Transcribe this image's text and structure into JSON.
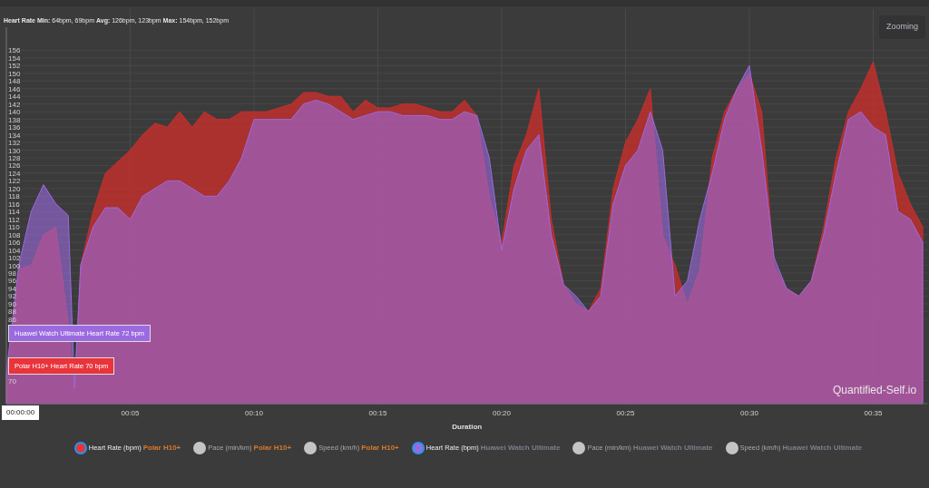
{
  "chart": {
    "title": "**Heart Rate Min:** 64bpm, 69bpm **Avg:** 126bpm, 123bpm **Max:** 154bpm, 152bpm",
    "zoom_button": "Zooming",
    "credit": "Quantified-Self.io",
    "crosshair_label": "00:00:00",
    "tooltips": [
      {
        "text": "Huawei Watch Ultimate Heart Rate 72 bpm",
        "color": "#9b6ae0"
      },
      {
        "text": "Polar H10+ Heart Rate 70 bpm",
        "color": "#e8343a"
      }
    ],
    "chart_data": {
      "type": "area",
      "grid": true,
      "xlabel": "Duration",
      "xlim": [
        0,
        37.2
      ],
      "ylim": [
        64,
        162
      ],
      "x": [
        0,
        0.5,
        1,
        1.5,
        2,
        2.5,
        2.75,
        3,
        3.5,
        4,
        4.5,
        5,
        5.5,
        6,
        6.5,
        7,
        7.5,
        8,
        8.5,
        9,
        9.5,
        10,
        10.5,
        11,
        11.5,
        12,
        12.5,
        13,
        13.5,
        14,
        14.5,
        15,
        15.5,
        16,
        16.5,
        17,
        17.5,
        18,
        18.5,
        19,
        19.5,
        20,
        20.5,
        21,
        21.5,
        22,
        22.5,
        23,
        23.5,
        24,
        24.5,
        25,
        25.5,
        26,
        26.5,
        27,
        27.5,
        28,
        28.5,
        29,
        29.5,
        30,
        30.5,
        31,
        31.5,
        32,
        32.5,
        33,
        33.5,
        34,
        34.5,
        35,
        35.5,
        36,
        36.5,
        37
      ],
      "xticks": [
        {
          "value": 5,
          "label": "00:05"
        },
        {
          "value": 10,
          "label": "00:10"
        },
        {
          "value": 15,
          "label": "00:15"
        },
        {
          "value": 20,
          "label": "00:20"
        },
        {
          "value": 25,
          "label": "00:25"
        },
        {
          "value": 30,
          "label": "00:30"
        },
        {
          "value": 35,
          "label": "00:35"
        }
      ],
      "yticks": [
        70,
        86,
        88,
        90,
        92,
        94,
        96,
        98,
        100,
        102,
        104,
        106,
        108,
        110,
        112,
        114,
        116,
        118,
        120,
        122,
        124,
        126,
        128,
        130,
        132,
        134,
        136,
        138,
        140,
        142,
        144,
        146,
        148,
        150,
        152,
        154,
        156
      ],
      "series": [
        {
          "color": "#c0302e",
          "values": [
            70,
            99,
            100,
            108,
            110,
            85,
            66,
            100,
            114,
            124,
            127,
            130,
            134,
            137,
            136,
            140,
            136,
            140,
            138,
            138,
            140,
            140,
            140,
            141,
            142,
            145,
            145,
            144,
            144,
            140,
            143,
            141,
            141,
            142,
            142,
            141,
            140,
            140,
            143,
            139,
            118,
            106,
            126,
            134,
            146,
            112,
            95,
            90,
            88,
            94,
            120,
            132,
            138,
            146,
            108,
            100,
            90,
            99,
            128,
            140,
            146,
            150,
            140,
            100,
            94,
            92,
            96,
            110,
            128,
            140,
            146,
            153,
            140,
            124,
            116,
            110
          ]
        },
        {
          "color": "#9b6ae0",
          "values": [
            72,
            100,
            114,
            121,
            116,
            113,
            68,
            100,
            110,
            115,
            115,
            112,
            118,
            120,
            122,
            122,
            120,
            118,
            118,
            122,
            128,
            138,
            138,
            138,
            138,
            142,
            143,
            142,
            140,
            138,
            139,
            140,
            140,
            139,
            139,
            139,
            138,
            138,
            140,
            139,
            128,
            104,
            120,
            130,
            134,
            108,
            95,
            92,
            88,
            92,
            116,
            126,
            130,
            140,
            130,
            92,
            96,
            112,
            124,
            138,
            146,
            152,
            130,
            102,
            94,
            92,
            96,
            108,
            124,
            138,
            140,
            136,
            134,
            114,
            112,
            106
          ]
        }
      ]
    }
  },
  "legend": [
    {
      "label": "Heart Rate (bpm)",
      "device": {
        "text": "Polar H10+",
        "color": "#d9782a"
      },
      "on": true,
      "color": "#e8343a"
    },
    {
      "label": "Pace (min/km)",
      "device": {
        "text": "Polar H10+",
        "color": "#d9782a"
      },
      "on": false
    },
    {
      "label": "Speed (km/h)",
      "device": {
        "text": "Polar H10+",
        "color": "#d9782a"
      },
      "on": false
    },
    {
      "label": "Heart Rate (bpm)",
      "device": {
        "text": "Huawei Watch Ultimate",
        "color": "#7a7f8c"
      },
      "on": true,
      "color": "#9b6ae0"
    },
    {
      "label": "Pace (min/km)",
      "device": {
        "text": "Huawei Watch Ultimate",
        "color": "#7a7f8c"
      },
      "on": false
    },
    {
      "label": "Speed (km/h)",
      "device": {
        "text": "Huawei Watch Ultimate",
        "color": "#7a7f8c"
      },
      "on": false
    }
  ]
}
